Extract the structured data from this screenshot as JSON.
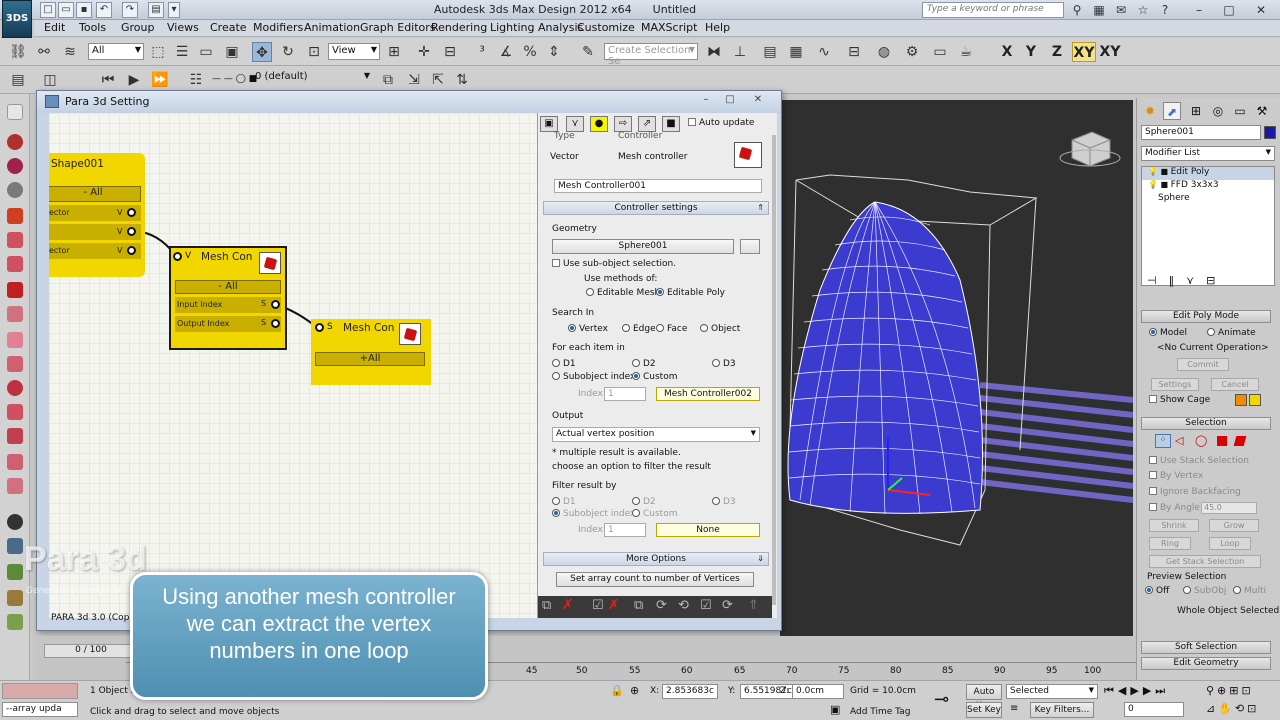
{
  "app": {
    "logo": "3DS",
    "title": "Autodesk 3ds Max Design 2012 x64",
    "document": "Untitled",
    "search_placeholder": "Type a keyword or phrase"
  },
  "menu": [
    "Edit",
    "Tools",
    "Group",
    "Views",
    "Create",
    "Modifiers",
    "Animation",
    "Graph Editors",
    "Rendering",
    "Lighting Analysis",
    "Customize",
    "MAXScript",
    "Help"
  ],
  "main_toolbar": {
    "selection_filter": "All",
    "ref_coord": "View",
    "named_selection_placeholder": "Create Selection Se",
    "axes": [
      "X",
      "Y",
      "Z",
      "XY",
      "XY"
    ]
  },
  "layer_toolbar": {
    "layer": "0 (default)"
  },
  "dialog": {
    "title": "Para 3d Setting",
    "nodes": {
      "shape": {
        "title": "Shape001",
        "all": "- All",
        "ports": [
          {
            "label": "ector",
            "tag": "V"
          },
          {
            "label": "",
            "tag": "V"
          },
          {
            "label": "ector",
            "tag": "V"
          }
        ]
      },
      "mesh1": {
        "port_tag": "V",
        "title": "Mesh Con",
        "all": "- All",
        "ports": [
          {
            "label": "Input Index",
            "tag": "S"
          },
          {
            "label": "Output Index",
            "tag": "S"
          }
        ]
      },
      "mesh2": {
        "port_tag": "S",
        "title": "Mesh Con",
        "all": "+All"
      }
    },
    "status": "PARA 3d 3.0 (Cop",
    "props": {
      "auto_update": "Auto update",
      "type_label": "Type",
      "controller_label": "Controller",
      "type_value": "Vector",
      "controller_value": "Mesh controller",
      "name": "Mesh Controller001",
      "section_controller": "Controller settings",
      "geometry_label": "Geometry",
      "geometry_value": "Sphere001",
      "use_subobject": "Use sub-object selection.",
      "use_methods": "Use methods of:",
      "editable_mesh": "Editable Mesh",
      "editable_poly": "Editable Poly",
      "search_in": "Search In",
      "vertex": "Vertex",
      "edge": "Edge",
      "face": "Face",
      "object": "Object",
      "for_each": "For each item in",
      "d1": "D1",
      "d2": "D2",
      "d3": "D3",
      "subobject_index": "Subobject index",
      "custom": "Custom",
      "index_label": "Index",
      "index_value": "1",
      "custom_target": "Mesh Controller002",
      "output_label": "Output",
      "output_value": "Actual vertex position",
      "note1": "* multiple result is available.",
      "note2": "choose an option to filter the result",
      "filter_by": "Filter result by",
      "filter_index_value": "1",
      "filter_target": "None",
      "more_options": "More Options",
      "set_array": "Set array count to number of Vertices"
    }
  },
  "command_panel": {
    "object_name": "Sphere001",
    "modifier_list": "Modifier List",
    "stack": [
      "Edit Poly",
      "FFD 3x3x3",
      "Sphere"
    ],
    "edit_poly_mode": "Edit Poly Mode",
    "model": "Model",
    "animate": "Animate",
    "no_operation": "<No Current Operation>",
    "commit": "Commit",
    "settings": "Settings",
    "cancel": "Cancel",
    "show_cage": "Show Cage",
    "selection": "Selection",
    "use_stack_selection": "Use Stack Selection",
    "by_vertex": "By Vertex",
    "ignore_backfacing": "Ignore Backfacing",
    "by_angle": "By Angle:",
    "angle_value": "45.0",
    "shrink": "Shrink",
    "grow": "Grow",
    "ring": "Ring",
    "loop": "Loop",
    "get_stack_selection": "Get Stack Selection",
    "preview_selection": "Preview Selection",
    "off": "Off",
    "subobj": "SubObj",
    "multi": "Multi",
    "whole_object": "Whole Object Selected",
    "soft_selection": "Soft Selection",
    "edit_geometry": "Edit Geometry"
  },
  "timeline": {
    "frame": "0 / 100",
    "ticks": [
      "45",
      "50",
      "55",
      "60",
      "65",
      "70",
      "75",
      "80",
      "85",
      "90",
      "95",
      "100"
    ]
  },
  "status": {
    "selected_count": "1 Object Sel",
    "script_listener": "--array upda",
    "prompt": "Click and drag to select and move objects",
    "x_label": "X:",
    "x_value": "2.853683c",
    "y_label": "Y:",
    "y_value": "6.551987c",
    "z_label": "Z:",
    "z_value": "0.0cm",
    "grid": "Grid = 10.0cm",
    "add_time_tag": "Add Time Tag",
    "auto_key": "Auto Key",
    "set_key": "Set Key",
    "key_mode": "Selected",
    "key_filters": "Key Filters...",
    "frame_field": "0"
  },
  "caption": {
    "line1": "Using another mesh controller",
    "line2": "we can extract the vertex",
    "line3": "numbers in one loop"
  },
  "watermark": {
    "title": "Para 3d",
    "subtitle": "Generative Design in"
  },
  "colors": {
    "node_yellow": "#f2d600",
    "mesh_blue": "#3b3bd0",
    "caption_blue": "#5f9fc0"
  }
}
